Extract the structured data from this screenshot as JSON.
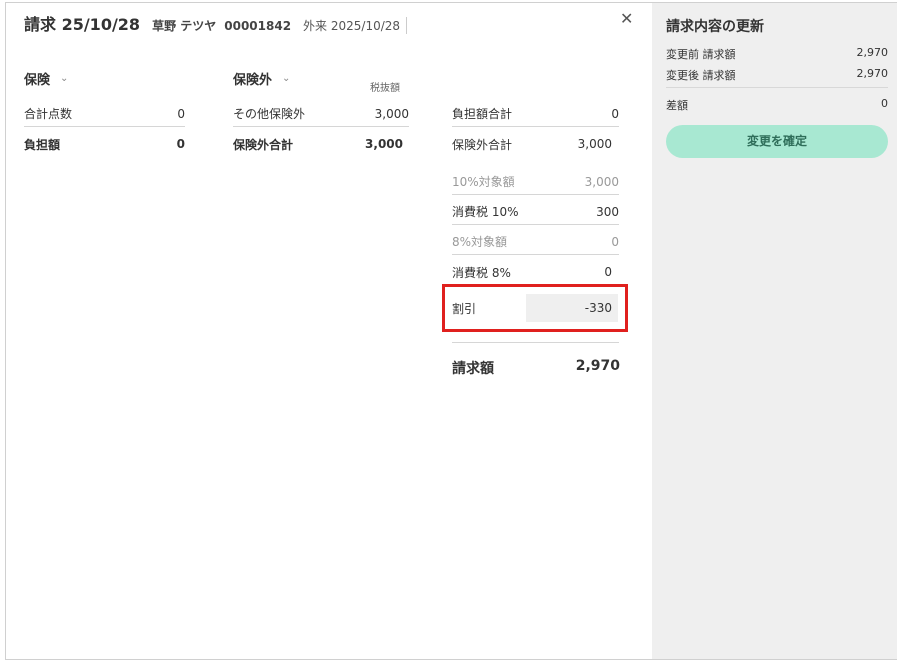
{
  "header": {
    "title": "請求 25/10/28",
    "patient_name": "草野 テツヤ",
    "patient_id": "00001842",
    "visit": "外来 2025/10/28",
    "close_icon": "close-icon"
  },
  "insurance": {
    "title": "保険",
    "rows": [
      {
        "label": "合計点数",
        "value": "0"
      },
      {
        "label": "負担額",
        "value": "0"
      }
    ]
  },
  "non_insurance": {
    "title": "保険外",
    "tax_note": "税抜額",
    "rows": [
      {
        "label": "その他保険外",
        "value": "3,000"
      },
      {
        "label": "保険外合計",
        "value": "3,000"
      }
    ]
  },
  "summary": {
    "rows": [
      {
        "label": "負担額合計",
        "value": "0"
      },
      {
        "label": "保険外合計",
        "value": "3,000"
      },
      {
        "label": "10%対象額",
        "value": "3,000"
      },
      {
        "label": "消費税 10%",
        "value": "300"
      },
      {
        "label": "8%対象額",
        "value": "0"
      },
      {
        "label": "消費税 8%",
        "value": "0"
      }
    ],
    "discount_label": "割引",
    "discount_value": "-330",
    "total_label": "請求額",
    "total_value": "2,970"
  },
  "side": {
    "title": "請求内容の更新",
    "rows": [
      {
        "label": "変更前 請求額",
        "value": "2,970"
      },
      {
        "label": "変更後 請求額",
        "value": "2,970"
      }
    ],
    "diff_label": "差額",
    "diff_value": "0",
    "confirm_label": "変更を確定"
  },
  "colors": {
    "highlight_border": "#e0201e",
    "confirm_button": "#a8e8d2",
    "side_panel": "#efefef"
  }
}
